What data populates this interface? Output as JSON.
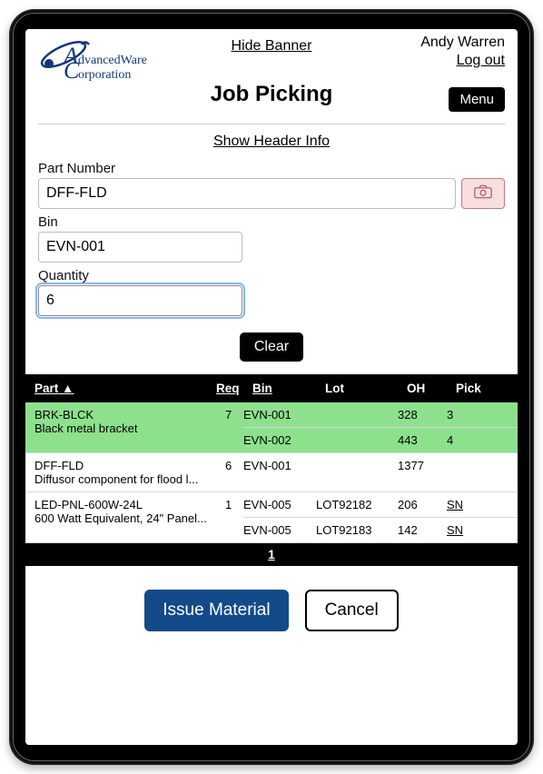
{
  "logo": {
    "line1": "dvancedWare",
    "line2": "orporation"
  },
  "header": {
    "hide_banner": "Hide Banner",
    "user_name": "Andy Warren",
    "logout": "Log out",
    "title": "Job Picking",
    "menu": "Menu",
    "show_header_info": "Show Header Info"
  },
  "form": {
    "part_label": "Part Number",
    "part_value": "DFF-FLD",
    "bin_label": "Bin",
    "bin_value": "EVN-001",
    "qty_label": "Quantity",
    "qty_value": "6",
    "clear": "Clear"
  },
  "table": {
    "columns": {
      "part": "Part",
      "req": "Req",
      "bin": "Bin",
      "lot": "Lot",
      "oh": "OH",
      "pick": "Pick"
    },
    "rows": [
      {
        "selected": true,
        "part": "BRK-BLCK",
        "desc": "Black metal bracket",
        "req": "7",
        "lots": [
          {
            "bin": "EVN-001",
            "lot": "",
            "oh": "328",
            "pick": "3",
            "sn": false
          },
          {
            "bin": "EVN-002",
            "lot": "",
            "oh": "443",
            "pick": "4",
            "sn": false
          }
        ]
      },
      {
        "selected": false,
        "part": "DFF-FLD",
        "desc": "Diffusor component for flood l...",
        "req": "6",
        "lots": [
          {
            "bin": "EVN-001",
            "lot": "",
            "oh": "1377",
            "pick": "",
            "sn": false
          }
        ]
      },
      {
        "selected": false,
        "part": "LED-PNL-600W-24L",
        "desc": "600 Watt Equivalent, 24\" Panel...",
        "req": "1",
        "lots": [
          {
            "bin": "EVN-005",
            "lot": "LOT92182",
            "oh": "206",
            "pick": "SN",
            "sn": true
          },
          {
            "bin": "EVN-005",
            "lot": "LOT92183",
            "oh": "142",
            "pick": "SN",
            "sn": true
          }
        ]
      }
    ],
    "page": "1"
  },
  "footer": {
    "issue": "Issue Material",
    "cancel": "Cancel"
  }
}
